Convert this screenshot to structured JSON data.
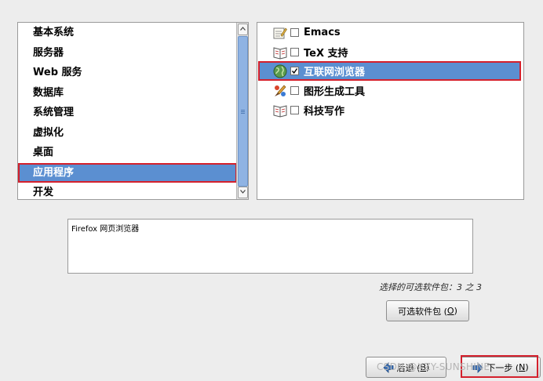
{
  "categories": [
    {
      "label": "基本系统"
    },
    {
      "label": "服务器"
    },
    {
      "label": "Web 服务"
    },
    {
      "label": "数据库"
    },
    {
      "label": "系统管理"
    },
    {
      "label": "虚拟化"
    },
    {
      "label": "桌面"
    },
    {
      "label": "应用程序",
      "selected": true
    },
    {
      "label": "开发"
    }
  ],
  "packages": [
    {
      "label": "Emacs",
      "checked": false,
      "icon": "editor-icon"
    },
    {
      "label": "TeX 支持",
      "checked": false,
      "icon": "book-icon"
    },
    {
      "label": "互联网浏览器",
      "checked": true,
      "selected": true,
      "icon": "globe-icon"
    },
    {
      "label": "图形生成工具",
      "checked": false,
      "icon": "paint-icon"
    },
    {
      "label": "科技写作",
      "checked": false,
      "icon": "book-icon"
    }
  ],
  "description": "Firefox 网页浏览器",
  "selection_count": "选择的可选软件包：3 之 3",
  "buttons": {
    "optional_packages_prefix": "可选软件包 (",
    "optional_packages_key": "O",
    "optional_packages_suffix": ")",
    "back_key": "B",
    "back_text": "后退 (",
    "back_suffix": ")",
    "next_key": "N",
    "next_text": "下一步 (",
    "next_suffix": ")"
  },
  "watermark": "CSDN @XZY-SUNSHINE",
  "colors": {
    "selection": "#5b8fd1",
    "highlight_box": "#d4202c"
  }
}
